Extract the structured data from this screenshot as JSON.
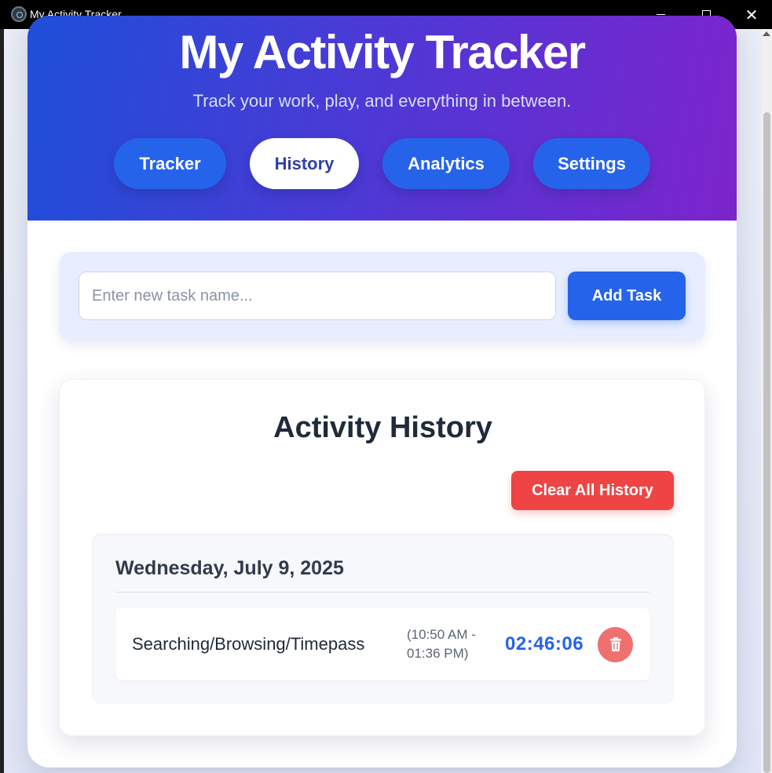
{
  "window": {
    "title": "My Activity Tracker"
  },
  "header": {
    "title": "My Activity Tracker",
    "subtitle": "Track your work, play, and everything in between."
  },
  "nav": {
    "tabs": [
      {
        "label": "Tracker",
        "active": false
      },
      {
        "label": "History",
        "active": true
      },
      {
        "label": "Analytics",
        "active": false
      },
      {
        "label": "Settings",
        "active": false
      }
    ]
  },
  "add_task": {
    "placeholder": "Enter new task name...",
    "value": "",
    "button_label": "Add Task"
  },
  "history": {
    "title": "Activity History",
    "clear_button_label": "Clear All History",
    "days": [
      {
        "date": "Wednesday, July 9, 2025",
        "entries": [
          {
            "name": "Searching/Browsing/Timepass",
            "time_range_line1": "(10:50 AM -",
            "time_range_line2": "01:36 PM)",
            "duration": "02:46:06",
            "delete_icon": "trash-icon"
          }
        ]
      }
    ]
  },
  "colors": {
    "primary": "#2563eb",
    "danger": "#ef4444",
    "header_gradient_start": "#1e4fd8",
    "header_gradient_end": "#7d24cc"
  }
}
